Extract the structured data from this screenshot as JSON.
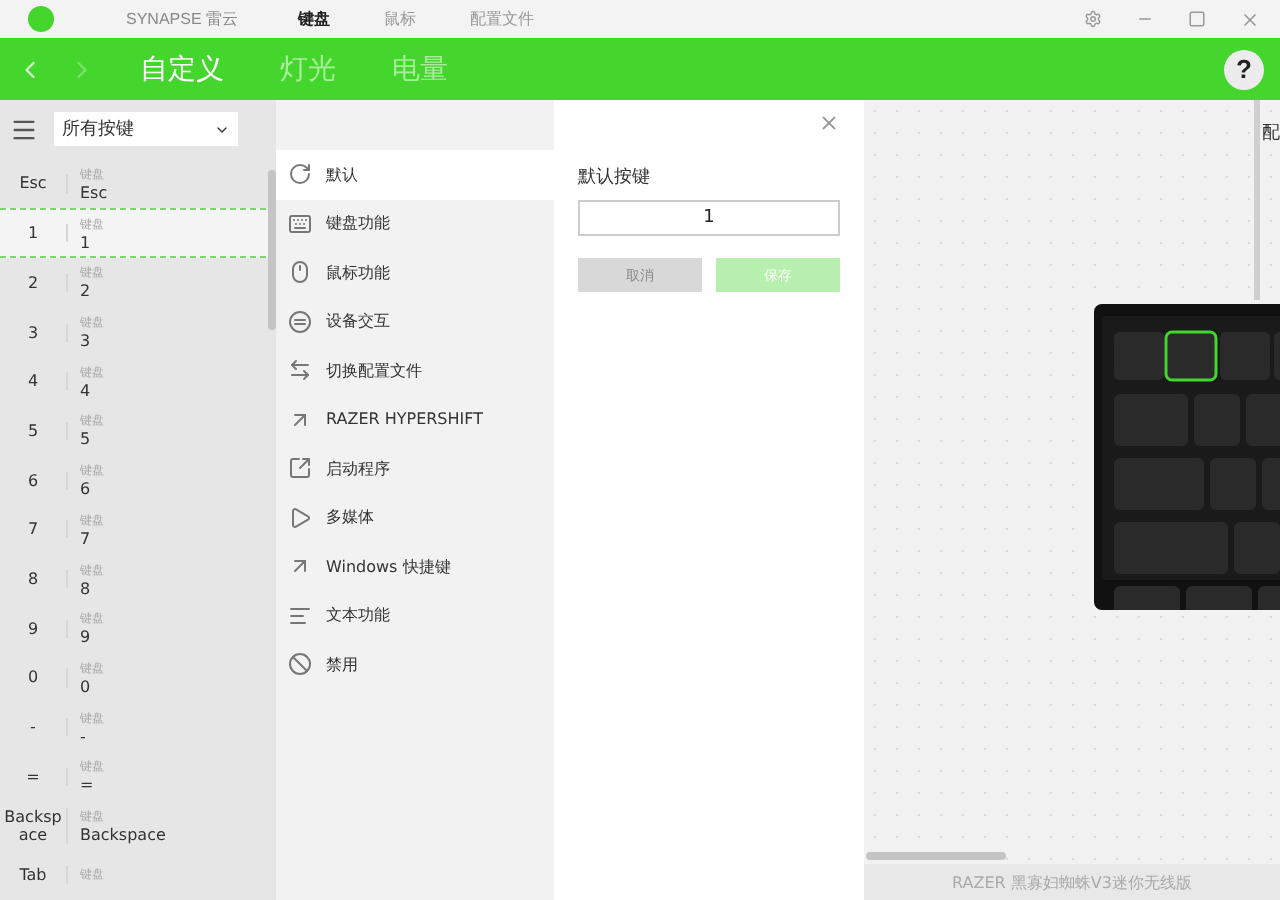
{
  "title_bar": {
    "app_name": "SYNAPSE 雷云",
    "tabs": [
      {
        "label": "键盘",
        "selected": true
      },
      {
        "label": "鼠标",
        "selected": false
      },
      {
        "label": "配置文件",
        "selected": false
      }
    ]
  },
  "sub_nav": {
    "tabs": [
      {
        "label": "自定义",
        "selected": true
      },
      {
        "label": "灯光",
        "selected": false
      },
      {
        "label": "电量",
        "selected": false
      }
    ],
    "help": "?"
  },
  "key_filter": {
    "value": "所有按键"
  },
  "keys": [
    {
      "key": "Esc",
      "category": "键盘",
      "value": "Esc",
      "selected": false
    },
    {
      "key": "1",
      "category": "键盘",
      "value": "1",
      "selected": true
    },
    {
      "key": "2",
      "category": "键盘",
      "value": "2",
      "selected": false
    },
    {
      "key": "3",
      "category": "键盘",
      "value": "3",
      "selected": false
    },
    {
      "key": "4",
      "category": "键盘",
      "value": "4",
      "selected": false
    },
    {
      "key": "5",
      "category": "键盘",
      "value": "5",
      "selected": false
    },
    {
      "key": "6",
      "category": "键盘",
      "value": "6",
      "selected": false
    },
    {
      "key": "7",
      "category": "键盘",
      "value": "7",
      "selected": false
    },
    {
      "key": "8",
      "category": "键盘",
      "value": "8",
      "selected": false
    },
    {
      "key": "9",
      "category": "键盘",
      "value": "9",
      "selected": false
    },
    {
      "key": "0",
      "category": "键盘",
      "value": "0",
      "selected": false
    },
    {
      "key": "-",
      "category": "键盘",
      "value": "-",
      "selected": false
    },
    {
      "key": "=",
      "category": "键盘",
      "value": "=",
      "selected": false
    },
    {
      "key": "Backspace",
      "category": "键盘",
      "value": "Backspace",
      "selected": false
    },
    {
      "key": "Tab",
      "category": "键盘",
      "selected": false
    }
  ],
  "functions": [
    {
      "kind": "default",
      "label": "默认",
      "selected": true
    },
    {
      "kind": "keyboard",
      "label": "键盘功能",
      "selected": false
    },
    {
      "kind": "mouse",
      "label": "鼠标功能",
      "selected": false
    },
    {
      "kind": "device",
      "label": "设备交互",
      "selected": false
    },
    {
      "kind": "switch",
      "label": "切换配置文件",
      "selected": false
    },
    {
      "kind": "arrow",
      "label": "RAZER HYPERSHIFT",
      "selected": false
    },
    {
      "kind": "launch",
      "label": "启动程序",
      "selected": false
    },
    {
      "kind": "media",
      "label": "多媒体",
      "selected": false
    },
    {
      "kind": "arrow",
      "label": "Windows 快捷键",
      "selected": false
    },
    {
      "kind": "text",
      "label": "文本功能",
      "selected": false
    },
    {
      "kind": "disable",
      "label": "禁用",
      "selected": false
    }
  ],
  "detail": {
    "title": "默认按键",
    "value": "1",
    "buttons": [
      {
        "label": "取消",
        "kind": "cancel"
      },
      {
        "label": "保存",
        "kind": "save"
      }
    ]
  },
  "canvas": {
    "edge_label": "配",
    "device_name": "RAZER 黑寡妇蜘蛛V3迷你无线版"
  }
}
